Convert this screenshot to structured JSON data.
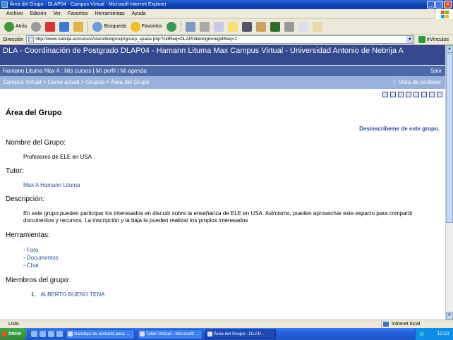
{
  "window": {
    "title": "Área del Grupo - DLAP04 - Campus Virtual - Microsoft Internet Explorer"
  },
  "menu": [
    "Archivo",
    "Edición",
    "Ver",
    "Favoritos",
    "Herramientas",
    "Ayuda"
  ],
  "toolbar": {
    "back_label": "Atrás",
    "search_label": "Búsqueda",
    "favorites_label": "Favoritos"
  },
  "address": {
    "label": "Dirección",
    "url": "http://www.nebrija.es/cursos/claroline/group/group_space.php?cidReq=DLAP04&origin=&gidReq=1",
    "go_label": "Ir",
    "links_label": "Vínculos"
  },
  "page": {
    "header": "DLA - Coordinación de Postgrado DLAP04 - Hamann Lituma Max  Campus Virtual - Universidad Antonio de Nebrija A",
    "userbar": {
      "user": "Hamann Lituma Max A",
      "sep": " : ",
      "mis_cursos": "Mis cursos",
      "mi_perfil": "Mi perfil",
      "mi_agenda": "Mi agenda",
      "salir": "Salir"
    },
    "breadcrumbs": {
      "c1": "Campus Virtual",
      "c2": "Curso actual",
      "c3": "Grupos",
      "c4": "Área del Grupo",
      "vista": "Vista de profesor"
    },
    "title": "Área del Grupo",
    "unsubscribe": "Desinscríbeme de este grupo.",
    "nombre_label": "Nombre del Grupo:",
    "nombre_value": "Profesores de ELE en USA",
    "tutor_label": "Tutor:",
    "tutor_value": "Max A Hamann Lituma",
    "desc_label": "Descripción:",
    "desc_value": "En este grupo pueden participar los interesados en discutir sobre la enseñanza de ELE en USA. Asimismo, pueden aprovechar este espacio para compartir documentos y recursos. La inscripción y la baja la pueden realizar los propios interesados",
    "tools_label": "Herramientas:",
    "tools": [
      "Foro",
      "Documentos",
      "Chat"
    ],
    "members_label": "Miembros del grupo:",
    "members": [
      {
        "num": "1.",
        "name": "ALBERTO BUENO TENA"
      }
    ]
  },
  "status": {
    "text": "Listo",
    "zone": "Intranet local"
  },
  "taskbar": {
    "start": "Inicio",
    "tasks": [
      "Bandeja de entrada para ...",
      "Taller Virtual - Microsoft ...",
      "Área del Grupo - DLAP..."
    ],
    "time": "12:21"
  }
}
